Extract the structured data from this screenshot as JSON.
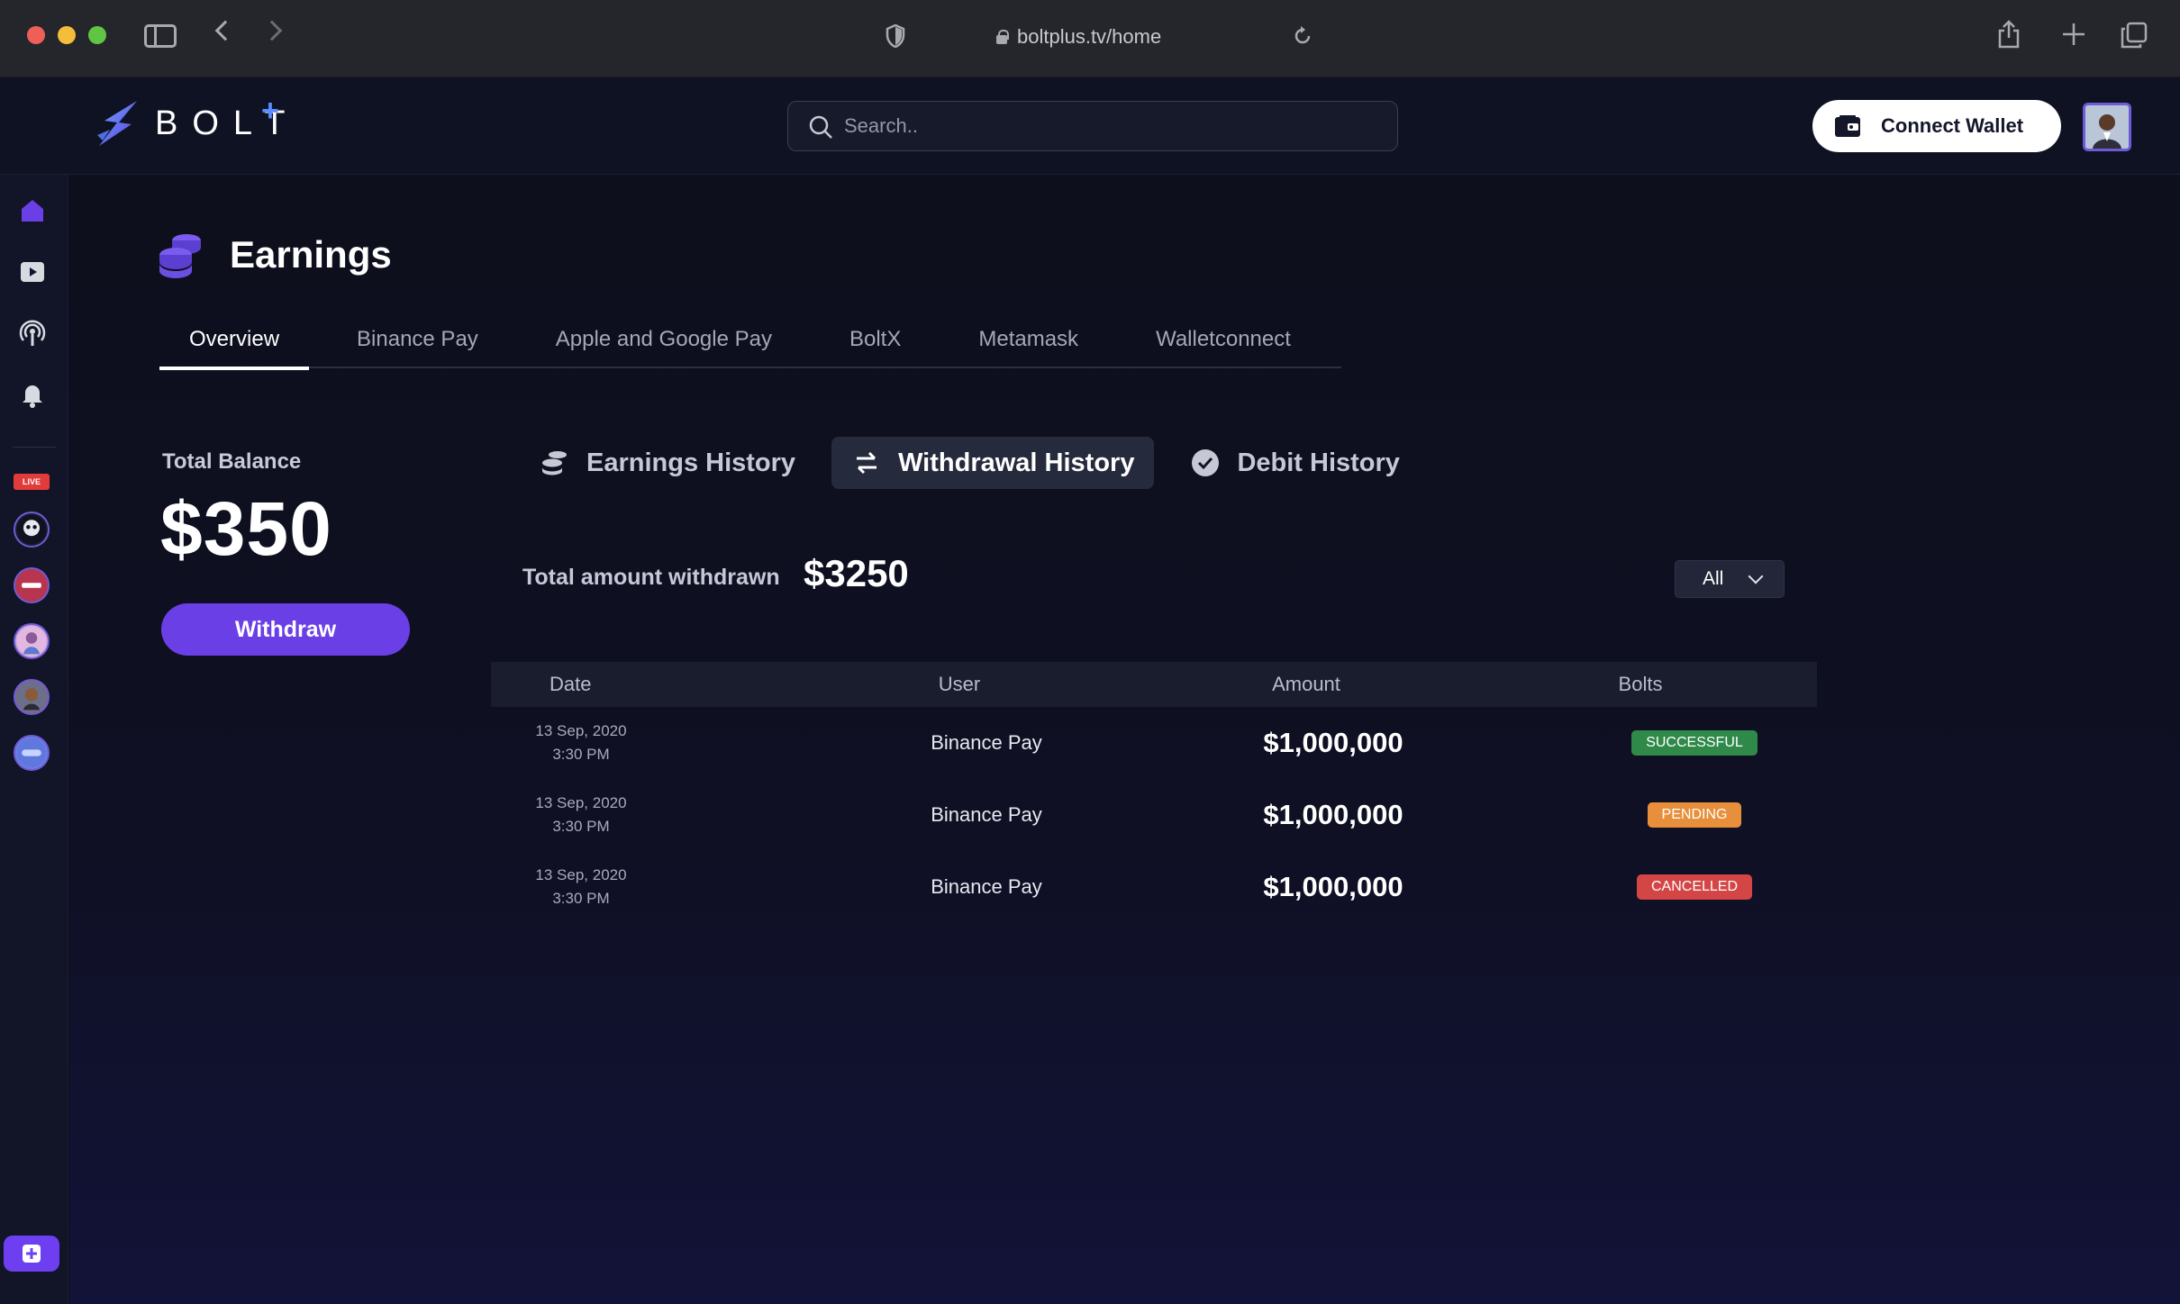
{
  "browser": {
    "url": "boltplus.tv/home"
  },
  "header": {
    "logo_text": "BOLT",
    "logo_plus": "+",
    "search_placeholder": "Search..",
    "connect_wallet_label": "Connect Wallet"
  },
  "rail": {
    "live_label": "LIVE",
    "icons": [
      "home-icon",
      "video-play-icon",
      "podcast-icon",
      "bell-icon"
    ],
    "channels": [
      "channel-avatar-1",
      "channel-avatar-2",
      "channel-avatar-3",
      "channel-avatar-4",
      "channel-avatar-5"
    ]
  },
  "page": {
    "title": "Earnings",
    "tabs": [
      {
        "label": "Overview",
        "active": true
      },
      {
        "label": "Binance Pay",
        "active": false
      },
      {
        "label": "Apple and Google Pay",
        "active": false
      },
      {
        "label": "BoltX",
        "active": false
      },
      {
        "label": "Metamask",
        "active": false
      },
      {
        "label": "Walletconnect",
        "active": false
      }
    ]
  },
  "balance": {
    "label": "Total Balance",
    "value": "$350",
    "withdraw_label": "Withdraw"
  },
  "history_tabs": [
    {
      "label": "Earnings History",
      "active": false
    },
    {
      "label": "Withdrawal History",
      "active": true
    },
    {
      "label": "Debit History",
      "active": false
    }
  ],
  "withdrawn": {
    "label": "Total amount withdrawn",
    "value": "$3250",
    "filter_selected": "All"
  },
  "table": {
    "columns": [
      "Date",
      "User",
      "Amount",
      "Bolts"
    ],
    "rows": [
      {
        "date": "13 Sep, 2020",
        "time": "3:30 PM",
        "user": "Binance Pay",
        "amount": "$1,000,000",
        "status": "SUCCESSFUL",
        "status_color": "#2f8a4a"
      },
      {
        "date": "13 Sep, 2020",
        "time": "3:30 PM",
        "user": "Binance Pay",
        "amount": "$1,000,000",
        "status": "PENDING",
        "status_color": "#e88f3b"
      },
      {
        "date": "13 Sep, 2020",
        "time": "3:30 PM",
        "user": "Binance Pay",
        "amount": "$1,000,000",
        "status": "CANCELLED",
        "status_color": "#d44646"
      }
    ]
  },
  "colors": {
    "accent": "#6a3fe6",
    "background": "#0d0f1c"
  }
}
